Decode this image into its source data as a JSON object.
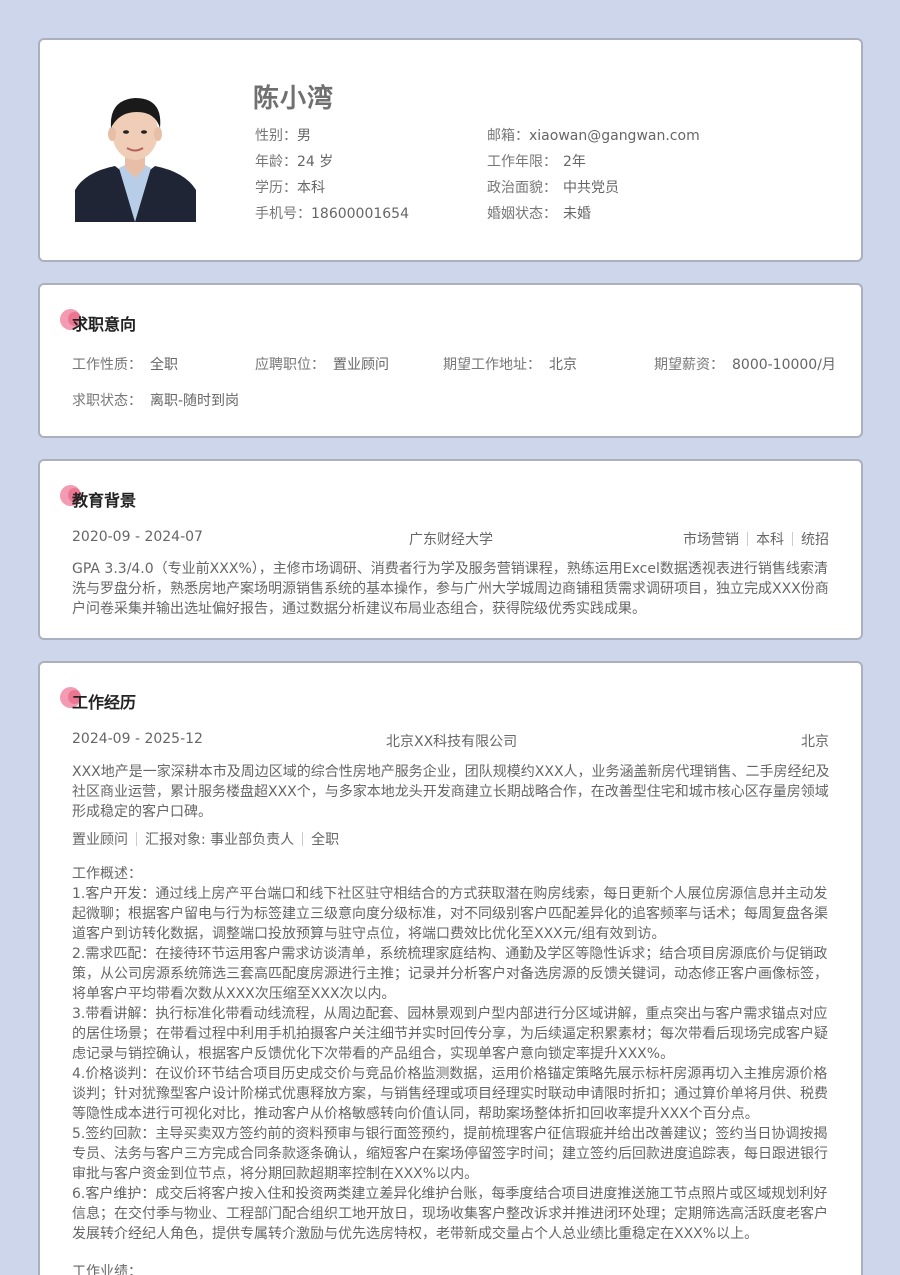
{
  "profile": {
    "name": "陈小湾",
    "left": [
      {
        "label": "性别：",
        "value": "男"
      },
      {
        "label": "年龄：",
        "value": "24 岁"
      },
      {
        "label": "学历：",
        "value": "本科"
      },
      {
        "label": "手机号：",
        "value": "18600001654"
      }
    ],
    "right": [
      {
        "label": "邮箱：",
        "value": "xiaowan@gangwan.com"
      },
      {
        "label": "工作年限：",
        "value": "2年"
      },
      {
        "label": "政治面貌：",
        "value": "中共党员"
      },
      {
        "label": "婚姻状态：",
        "value": "未婚"
      }
    ]
  },
  "intent": {
    "title": "求职意向",
    "items": [
      {
        "label": "工作性质：",
        "value": "全职"
      },
      {
        "label": "应聘职位：",
        "value": "置业顾问"
      },
      {
        "label": "期望工作地址：",
        "value": "北京"
      },
      {
        "label": "期望薪资：",
        "value": "8000-10000/月"
      },
      {
        "label": "求职状态：",
        "value": "离职-随时到岗"
      }
    ]
  },
  "education": {
    "title": "教育背景",
    "period": "2020-09 - 2024-07",
    "school": "广东财经大学",
    "tags": [
      "市场营销",
      "本科",
      "统招"
    ],
    "description": "GPA 3.3/4.0（专业前XXX%），主修市场调研、消费者行为学及服务营销课程，熟练运用Excel数据透视表进行销售线索清洗与罗盘分析，熟悉房地产案场明源销售系统的基本操作，参与广州大学城周边商铺租赁需求调研项目，独立完成XXX份商户问卷采集并输出选址偏好报告，通过数据分析建议布局业态组合，获得院级优秀实践成果。"
  },
  "work": {
    "title": "工作经历",
    "period": "2024-09 - 2025-12",
    "company": "北京XX科技有限公司",
    "city": "北京",
    "company_desc": "XXX地产是一家深耕本市及周边区域的综合性房地产服务企业，团队规模约XXX人，业务涵盖新房代理销售、二手房经纪及社区商业运营，累计服务楼盘超XXX个，与多家本地龙头开发商建立长期战略合作，在改善型住宅和城市核心区存量房领域形成稳定的客户口碑。",
    "tags": [
      "置业顾问",
      "汇报对象: 事业部负责人",
      "全职"
    ],
    "overview_label": "工作概述：",
    "overview": "1.客户开发：通过线上房产平台端口和线下社区驻守相结合的方式获取潜在购房线索，每日更新个人展位房源信息并主动发起微聊；根据客户留电与行为标签建立三级意向度分级标准，对不同级别客户匹配差异化的追客频率与话术；每周复盘各渠道客户到访转化数据，调整端口投放预算与驻守点位，将端口费效比优化至XXX元/组有效到访。\n2.需求匹配：在接待环节运用客户需求访谈清单，系统梳理家庭结构、通勤及学区等隐性诉求；结合项目房源底价与促销政策，从公司房源系统筛选三套高匹配度房源进行主推；记录并分析客户对备选房源的反馈关键词，动态修正客户画像标签，将单客户平均带看次数从XXX次压缩至XXX次以内。\n3.带看讲解：执行标准化带看动线流程，从周边配套、园林景观到户型内部进行分区域讲解，重点突出与客户需求锚点对应的居住场景；在带看过程中利用手机拍摄客户关注细节并实时回传分享，为后续逼定积累素材；每次带看后现场完成客户疑虑记录与销控确认，根据客户反馈优化下次带看的产品组合，实现单客户意向锁定率提升XXX%。\n4.价格谈判：在议价环节结合项目历史成交价与竞品价格监测数据，运用价格锚定策略先展示标杆房源再切入主推房源价格谈判；针对犹豫型客户设计阶梯式优惠释放方案，与销售经理或项目经理实时联动申请限时折扣；通过算价单将月供、税费等隐性成本进行可视化对比，推动客户从价格敏感转向价值认同，帮助案场整体折扣回收率提升XXX个百分点。\n5.签约回款：主导买卖双方签约前的资料预审与银行面签预约，提前梳理客户征信瑕疵并给出改善建议；签约当日协调按揭专员、法务与客户三方完成合同条款逐条确认，缩短客户在案场停留签字时间；建立签约后回款进度追踪表，每日跟进银行审批与客户资金到位节点，将分期回款超期率控制在XXX%以内。\n6.客户维护：成交后将客户按入住和投资两类建立差异化维护台账，每季度结合项目进度推送施工节点照片或区域规划利好信息；在交付季与物业、工程部门配合组织工地开放日，现场收集客户整改诉求并推进闭环处理；定期筛选高活跃度老客户发展转介经纪人角色，提供专属转介激励与优先选房特权，老带新成交量占个人总业绩比重稳定在XXX%以上。",
    "results_label": "工作业绩："
  }
}
